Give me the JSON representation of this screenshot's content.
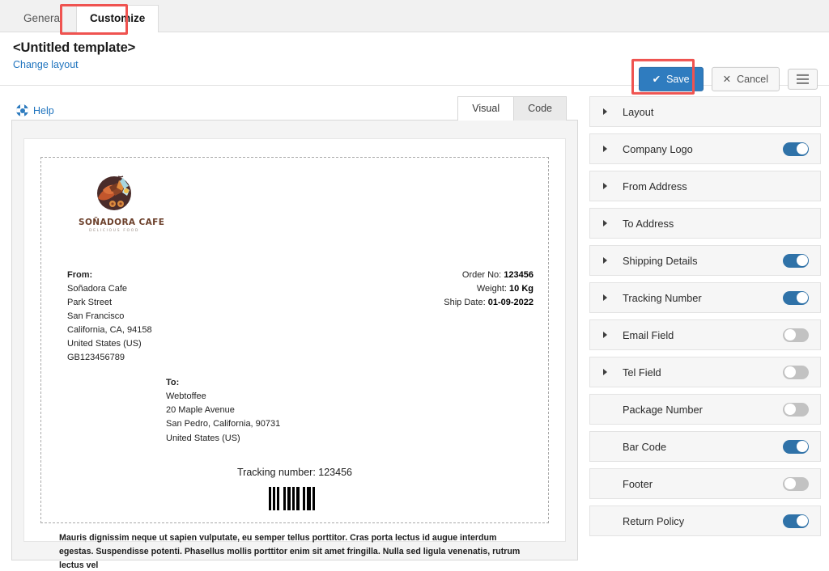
{
  "tabs": {
    "items": [
      {
        "label": "General",
        "active": false
      },
      {
        "label": "Customize",
        "active": true
      }
    ]
  },
  "header": {
    "title": "<Untitled template>",
    "change_layout_label": "Change layout",
    "save_label": "Save",
    "save_icon": "check-icon",
    "cancel_label": "Cancel",
    "cancel_icon": "close-icon",
    "menu_icon": "hamburger-icon"
  },
  "editor": {
    "help_label": "Help",
    "help_icon": "help-icon",
    "view_tabs": [
      {
        "label": "Visual",
        "active": true
      },
      {
        "label": "Code",
        "active": false
      }
    ]
  },
  "label": {
    "logo": {
      "name": "SOÑADORA CAFE",
      "tagline": "DELICIOUS FOOD",
      "art_icon": "cafe-plate-logo-icon"
    },
    "from": {
      "heading": "From:",
      "lines": [
        "Soñadora Cafe",
        "Park Street",
        "San Francisco",
        "California, CA, 94158",
        "United States (US)",
        "GB123456789"
      ]
    },
    "to": {
      "heading": "To:",
      "lines": [
        "Webtoffee",
        "20 Maple Avenue",
        "San Pedro, California, 90731",
        "United States (US)"
      ]
    },
    "order_meta": [
      {
        "label": "Order No:",
        "value": "123456"
      },
      {
        "label": "Weight:",
        "value": "10 Kg"
      },
      {
        "label": "Ship Date:",
        "value": "01-09-2022"
      }
    ],
    "tracking_text": "Tracking number: 123456",
    "barcode_icon": "barcode-icon",
    "footer_text": "Mauris dignissim neque ut sapien vulputate, eu semper tellus porttitor. Cras porta lectus id augue interdum egestas. Suspendisse potenti. Phasellus mollis porttitor enim sit amet fringilla. Nulla sed ligula venenatis, rutrum lectus vel"
  },
  "sidebar": {
    "items": [
      {
        "label": "Layout",
        "arrow": true,
        "toggle": null
      },
      {
        "label": "Company Logo",
        "arrow": true,
        "toggle": "on"
      },
      {
        "label": "From Address",
        "arrow": true,
        "toggle": null
      },
      {
        "label": "To Address",
        "arrow": true,
        "toggle": null
      },
      {
        "label": "Shipping Details",
        "arrow": true,
        "toggle": "on"
      },
      {
        "label": "Tracking Number",
        "arrow": true,
        "toggle": "on"
      },
      {
        "label": "Email Field",
        "arrow": true,
        "toggle": "off"
      },
      {
        "label": "Tel Field",
        "arrow": true,
        "toggle": "off"
      },
      {
        "label": "Package Number",
        "arrow": false,
        "toggle": "off"
      },
      {
        "label": "Bar Code",
        "arrow": false,
        "toggle": "on"
      },
      {
        "label": "Footer",
        "arrow": false,
        "toggle": "off"
      },
      {
        "label": "Return Policy",
        "arrow": false,
        "toggle": "on"
      }
    ]
  },
  "colors": {
    "accent_blue": "#2f7cbf",
    "toggle_on": "#2f72a8",
    "toggle_off": "#c2c2c2",
    "highlight_red": "#ef5350",
    "link_blue": "#1e73be"
  }
}
